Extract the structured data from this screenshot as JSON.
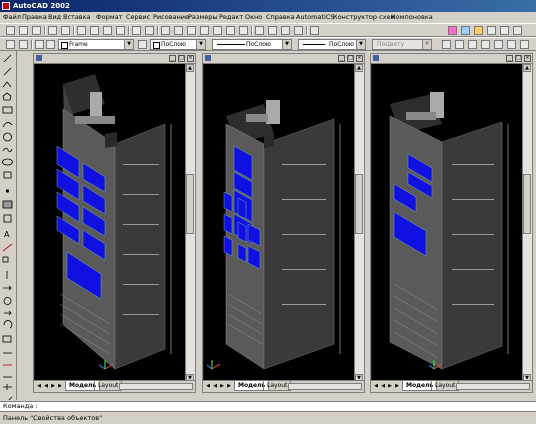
{
  "window": {
    "title": "AutoCAD 2002"
  },
  "menu": [
    "Файл",
    "Правка",
    "Вид",
    "Вставка",
    "Формат",
    "Сервис",
    "Рисование",
    "Размеры",
    "Редакт",
    "Окно",
    "Справка",
    "AutomatiCS",
    "Конструктор схем",
    "Компоновка"
  ],
  "properties_toolbar": {
    "layer_value": "Frame",
    "color_value": "ПоСлою",
    "linetype_value": "ПоСлою",
    "lineweight_value": "ПоСлою",
    "plotstyle_value": "ПоЦвету"
  },
  "viewports": [
    {
      "tabs": [
        "Модель",
        "Layout"
      ],
      "active_tab": "Модель"
    },
    {
      "tabs": [
        "Модель",
        "Layout"
      ],
      "active_tab": "Модель"
    },
    {
      "tabs": [
        "Модель",
        "Layout"
      ],
      "active_tab": "Модель"
    }
  ],
  "command_line": {
    "text": "Команда :"
  },
  "status_bar": {
    "text": "Панель \"Свойства объектов\""
  },
  "colors": {
    "titlebar": "#0a246a",
    "panel": "#d4d0c8",
    "viewport_bg": "#000000",
    "cabinet_face": "#5a5a5a",
    "cabinet_side": "#3a3a3a",
    "screen_blue": "#1010e0"
  }
}
